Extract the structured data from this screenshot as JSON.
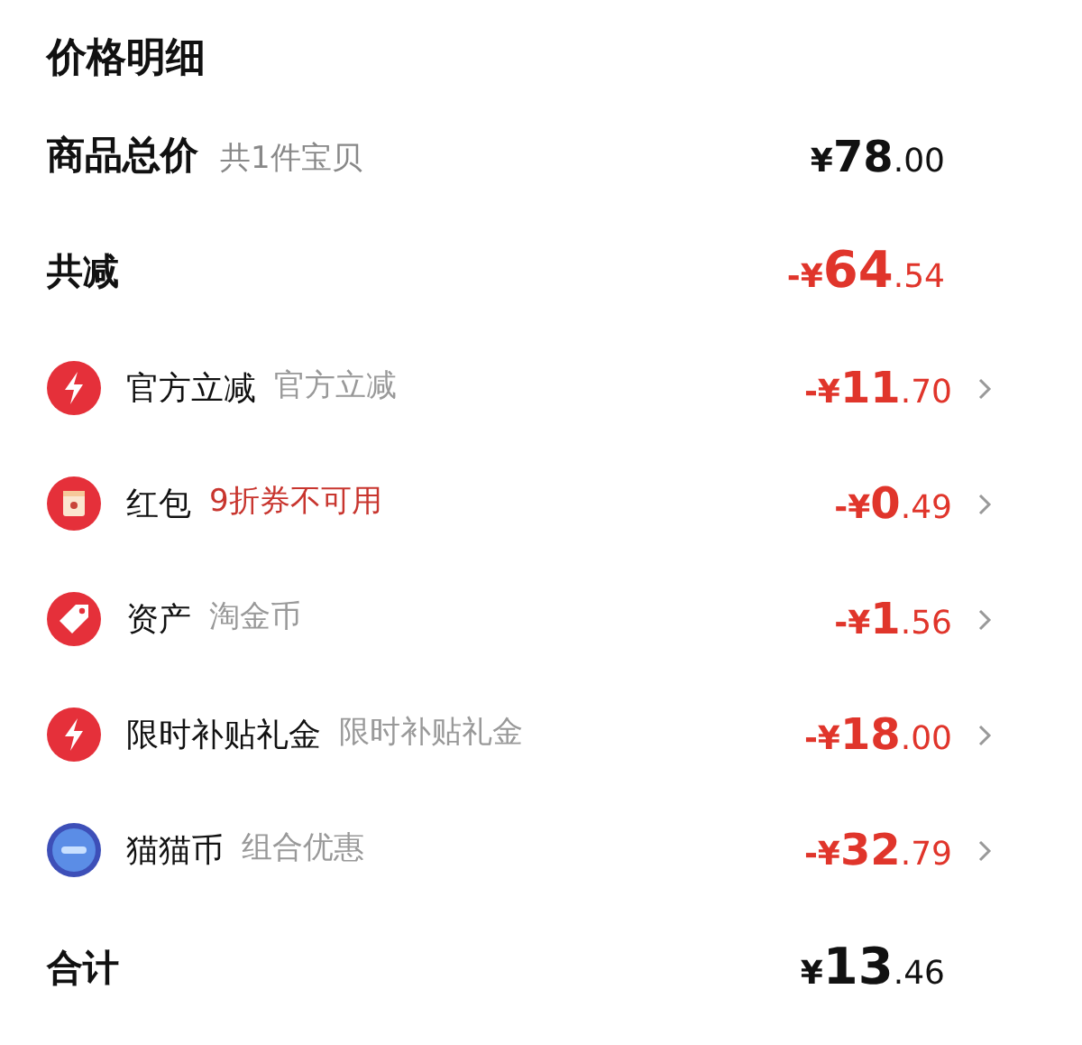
{
  "title": "价格明细",
  "subtotal": {
    "label": "商品总价",
    "note": "共1件宝贝",
    "price": {
      "prefix": "¥",
      "int": "78",
      "dec": ".00"
    }
  },
  "discount_total": {
    "label": "共减",
    "price": {
      "prefix": "-¥",
      "int": "64",
      "dec": ".54"
    }
  },
  "discounts": [
    {
      "kind": "bolt",
      "label": "官方立减",
      "note": "官方立减",
      "note_alert": false,
      "price": {
        "prefix": "-¥",
        "int": "11",
        "dec": ".70"
      }
    },
    {
      "kind": "red-packet",
      "label": "红包",
      "note": "9折券不可用",
      "note_alert": true,
      "price": {
        "prefix": "-¥",
        "int": "0",
        "dec": ".49"
      }
    },
    {
      "kind": "tag",
      "label": "资产",
      "note": "淘金币",
      "note_alert": false,
      "price": {
        "prefix": "-¥",
        "int": "1",
        "dec": ".56"
      }
    },
    {
      "kind": "bolt",
      "label": "限时补贴礼金",
      "note": "限时补贴礼金",
      "note_alert": false,
      "price": {
        "prefix": "-¥",
        "int": "18",
        "dec": ".00"
      }
    },
    {
      "kind": "coin",
      "label": "猫猫币",
      "note": "组合优惠",
      "note_alert": false,
      "price": {
        "prefix": "-¥",
        "int": "32",
        "dec": ".79"
      }
    }
  ],
  "total": {
    "label": "合计",
    "price": {
      "prefix": "¥",
      "int": "13",
      "dec": ".46"
    }
  }
}
